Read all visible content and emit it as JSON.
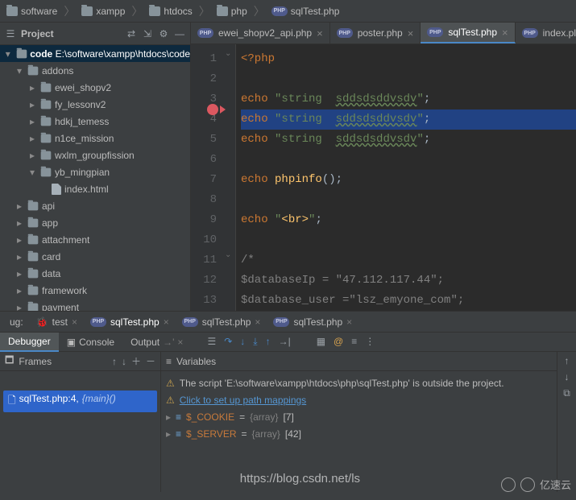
{
  "breadcrumb": [
    {
      "label": "software"
    },
    {
      "label": "xampp"
    },
    {
      "label": "htdocs"
    },
    {
      "label": "php"
    },
    {
      "label": "sqlTest.php",
      "file": true
    }
  ],
  "project": {
    "title": "Project",
    "root": "code",
    "root_path": "E:\\software\\xampp\\htdocs\\code",
    "nodes": [
      {
        "label": "addons",
        "depth": 1,
        "expanded": true
      },
      {
        "label": "ewei_shopv2",
        "depth": 2
      },
      {
        "label": "fy_lessonv2",
        "depth": 2
      },
      {
        "label": "hdkj_temess",
        "depth": 2
      },
      {
        "label": "n1ce_mission",
        "depth": 2
      },
      {
        "label": "wxlm_groupfission",
        "depth": 2
      },
      {
        "label": "yb_mingpian",
        "depth": 2,
        "expanded": true
      },
      {
        "label": "index.html",
        "depth": 3,
        "file": true
      },
      {
        "label": "api",
        "depth": 1
      },
      {
        "label": "app",
        "depth": 1
      },
      {
        "label": "attachment",
        "depth": 1
      },
      {
        "label": "card",
        "depth": 1
      },
      {
        "label": "data",
        "depth": 1
      },
      {
        "label": "framework",
        "depth": 1
      },
      {
        "label": "payment",
        "depth": 1
      }
    ]
  },
  "tabs": [
    {
      "label": "ewei_shopv2_api.php"
    },
    {
      "label": "poster.php"
    },
    {
      "label": "sqlTest.php",
      "active": true
    },
    {
      "label": "index.pl"
    }
  ],
  "code": {
    "lines": [
      {
        "n": 1,
        "html": "<span class='p'>&lt;?php</span>"
      },
      {
        "n": 2,
        "html": ""
      },
      {
        "n": 3,
        "html": "<span class='k'>echo</span> <span class='s'>\"string  </span><span class='s wave'>sddsdsddvsdv</span><span class='s'>\"</span><span class='op'>;</span>"
      },
      {
        "n": 4,
        "html": "<span class='k'>echo</span> <span class='s'>\"string  </span><span class='s wave'>sddsdsddvsdv</span><span class='s'>\"</span><span class='op'>;</span>",
        "hl": true
      },
      {
        "n": 5,
        "html": "<span class='k'>echo</span> <span class='s'>\"string  </span><span class='s wave'>sddsdsddvsdv</span><span class='s'>\"</span><span class='op'>;</span>"
      },
      {
        "n": 6,
        "html": ""
      },
      {
        "n": 7,
        "html": "<span class='k'>echo</span> <span class='fn'>phpinfo</span><span class='op'>()</span><span class='op'>;</span>"
      },
      {
        "n": 8,
        "html": ""
      },
      {
        "n": 9,
        "html": "<span class='k'>echo</span> <span class='s'>\"</span><span class='tag'>&lt;br&gt;</span><span class='s'>\"</span><span class='op'>;</span>"
      },
      {
        "n": 10,
        "html": ""
      },
      {
        "n": 11,
        "html": "<span class='c'>/*</span>"
      },
      {
        "n": 12,
        "html": "<span class='c'>$databaseIp = \"47.112.117.44\";</span>"
      },
      {
        "n": 13,
        "html": "<span class='c'>$database_user =\"lsz_emyone_com\";</span>"
      }
    ]
  },
  "debug": {
    "label": "ug:",
    "run_tabs": [
      {
        "label": "test"
      },
      {
        "label": "sqlTest.php",
        "active": true
      },
      {
        "label": "sqlTest.php"
      },
      {
        "label": "sqlTest.php"
      }
    ],
    "subtabs": {
      "debugger": "Debugger",
      "console": "Console",
      "output": "Output"
    },
    "frames": {
      "title": "Frames",
      "row": {
        "file": "sqlTest.php:4,",
        "meta": "{main}()"
      }
    },
    "vars": {
      "title": "Variables",
      "warn1": "The script 'E:\\software\\xampp\\htdocs\\php\\sqlTest.php' is outside the project.",
      "link": "Click to set up path mappings",
      "v1": {
        "name": "$_COOKIE",
        "eq": "=",
        "type": "{array}",
        "count": "[7]"
      },
      "v2": {
        "name": "$_SERVER",
        "eq": "=",
        "type": "{array}",
        "count": "[42]"
      }
    }
  },
  "watermark": "https://blog.csdn.net/ls",
  "badge": "亿速云"
}
